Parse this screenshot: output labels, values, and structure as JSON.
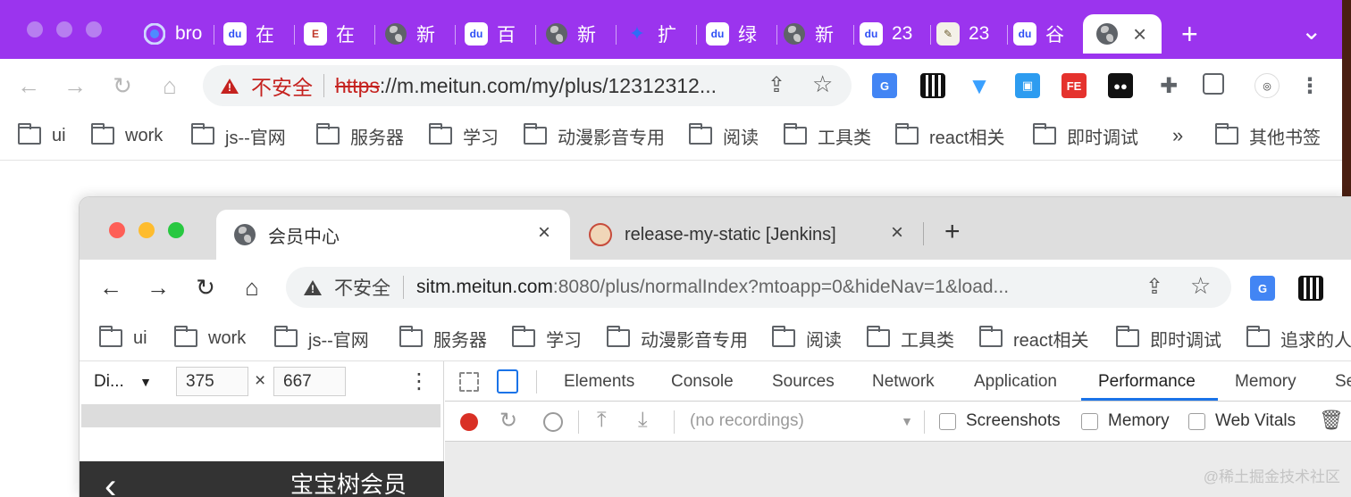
{
  "outer_browser": {
    "tabs": [
      {
        "title": "bro",
        "icon": "chrome-icon"
      },
      {
        "title": "在",
        "icon": "baidu-icon"
      },
      {
        "title": "在",
        "icon": "document-icon"
      },
      {
        "title": "新",
        "icon": "globe-icon"
      },
      {
        "title": "百",
        "icon": "baidu-icon"
      },
      {
        "title": "新",
        "icon": "globe-icon"
      },
      {
        "title": "扩",
        "icon": "puzzle-icon"
      },
      {
        "title": "绿",
        "icon": "baidu-icon"
      },
      {
        "title": "新",
        "icon": "globe-icon"
      },
      {
        "title": "23",
        "icon": "baidu-icon"
      },
      {
        "title": "23",
        "icon": "note-icon"
      },
      {
        "title": "谷",
        "icon": "baidu-icon"
      }
    ],
    "active_tab_close": "×",
    "new_tab": "+",
    "tab_menu": "⌄",
    "security_label": "不安全",
    "url_scheme": "https",
    "url_rest": "://m.meitun.com/my/plus/12312312...",
    "bookmarks": [
      "ui",
      "work",
      "js--官网",
      "服务器",
      "学习",
      "动漫影音专用",
      "阅读",
      "工具类",
      "react相关",
      "即时调试"
    ],
    "bookmarks_overflow": "»",
    "other_bookmarks": "其他书签",
    "colors": {
      "tabstrip": "#9b34ee",
      "insecure": "#c5221f"
    }
  },
  "inner_browser": {
    "tabs": [
      {
        "title": "会员中心",
        "icon": "globe-icon",
        "active": true
      },
      {
        "title": "release-my-static [Jenkins]",
        "icon": "jenkins-icon",
        "active": false
      }
    ],
    "close_glyph": "×",
    "new_tab": "+",
    "security_label": "不安全",
    "url_host": "sitm.meitun.com",
    "url_rest": ":8080/plus/normalIndex?mtoapp=0&hideNav=1&load...",
    "bookmarks": [
      "ui",
      "work",
      "js--官网",
      "服务器",
      "学习",
      "动漫影音专用",
      "阅读",
      "工具类",
      "react相关",
      "即时调试",
      "追求的人"
    ],
    "device_toolbar": {
      "device": "Di...",
      "width": "375",
      "times": "×",
      "height": "667"
    },
    "page_header_title": "宝宝树会员",
    "back_glyph": "‹"
  },
  "devtools": {
    "tabs": [
      "Elements",
      "Console",
      "Sources",
      "Network",
      "Application",
      "Performance",
      "Memory",
      "Se"
    ],
    "active_tab": "Performance",
    "recordings_placeholder": "(no recordings)",
    "checkboxes": [
      {
        "label": "Screenshots",
        "checked": false
      },
      {
        "label": "Memory",
        "checked": false
      },
      {
        "label": "Web Vitals",
        "checked": false
      }
    ]
  },
  "watermark": "@稀土掘金技术社区"
}
